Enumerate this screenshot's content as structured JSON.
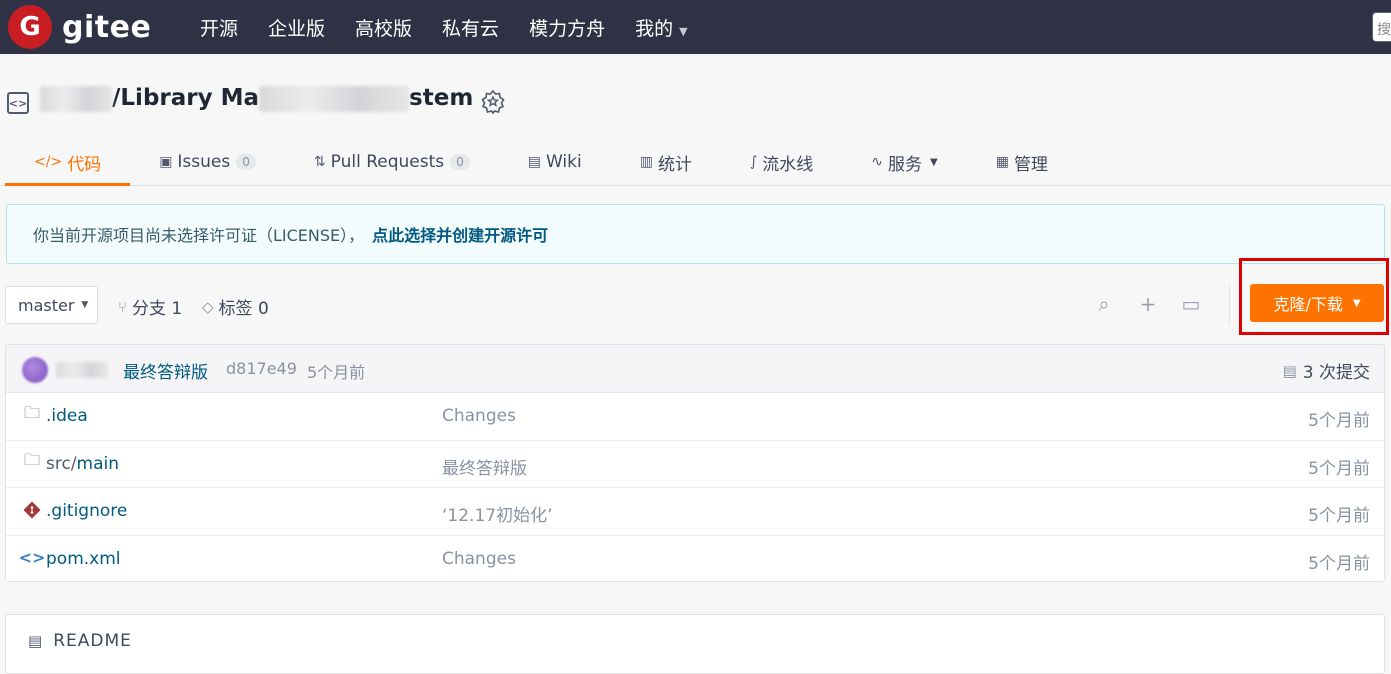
{
  "topnav": {
    "logo_letter": "G",
    "logo_text": "gitee",
    "items": [
      {
        "label": "开源"
      },
      {
        "label": "企业版"
      },
      {
        "label": "高校版"
      },
      {
        "label": "私有云"
      },
      {
        "label": "模力方舟"
      },
      {
        "label": "我的"
      }
    ],
    "search_stub": "搜"
  },
  "repo": {
    "title_suffix": "/Library Ma",
    "title_tail": "stem"
  },
  "tabs": [
    {
      "label": "代码",
      "icon": "code-icon",
      "active": true
    },
    {
      "label": "Issues",
      "icon": "issues-icon",
      "count": "0"
    },
    {
      "label": "Pull Requests",
      "icon": "pull-request-icon",
      "count": "0"
    },
    {
      "label": "Wiki",
      "icon": "wiki-icon"
    },
    {
      "label": "统计",
      "icon": "stats-icon"
    },
    {
      "label": "流水线",
      "icon": "pipeline-icon"
    },
    {
      "label": "服务",
      "icon": "service-icon"
    },
    {
      "label": "管理",
      "icon": "manage-icon"
    }
  ],
  "notice": {
    "text": "你当前开源项目尚未选择许可证（LICENSE），",
    "link": "点此选择并创建开源许可"
  },
  "branch_bar": {
    "branch": "master",
    "branches": "分支 1",
    "tags": "标签 0",
    "clone_label": "克隆/下载"
  },
  "last_commit": {
    "message": "最终答辩版",
    "hash": "d817e49",
    "time": "5个月前",
    "count": "3 次提交"
  },
  "files": [
    {
      "name": ".idea",
      "prefix": "",
      "icon": "folder-icon",
      "message": "Changes",
      "time": "5个月前"
    },
    {
      "name": "main",
      "prefix": "src/",
      "icon": "folder-icon",
      "message": "最终答辩版",
      "time": "5个月前"
    },
    {
      "name": ".gitignore",
      "prefix": "",
      "icon": "git-icon",
      "message": "‘12.17初始化’",
      "time": "5个月前"
    },
    {
      "name": "pom.xml",
      "prefix": "",
      "icon": "code-file-icon",
      "message": "Changes",
      "time": "5个月前"
    }
  ],
  "readme": {
    "title": "README"
  },
  "colors": {
    "accent": "#fe7300",
    "nav_bg": "#2e3244",
    "logo_red": "#c71d23",
    "link": "#005980",
    "highlight": "#e00000"
  }
}
